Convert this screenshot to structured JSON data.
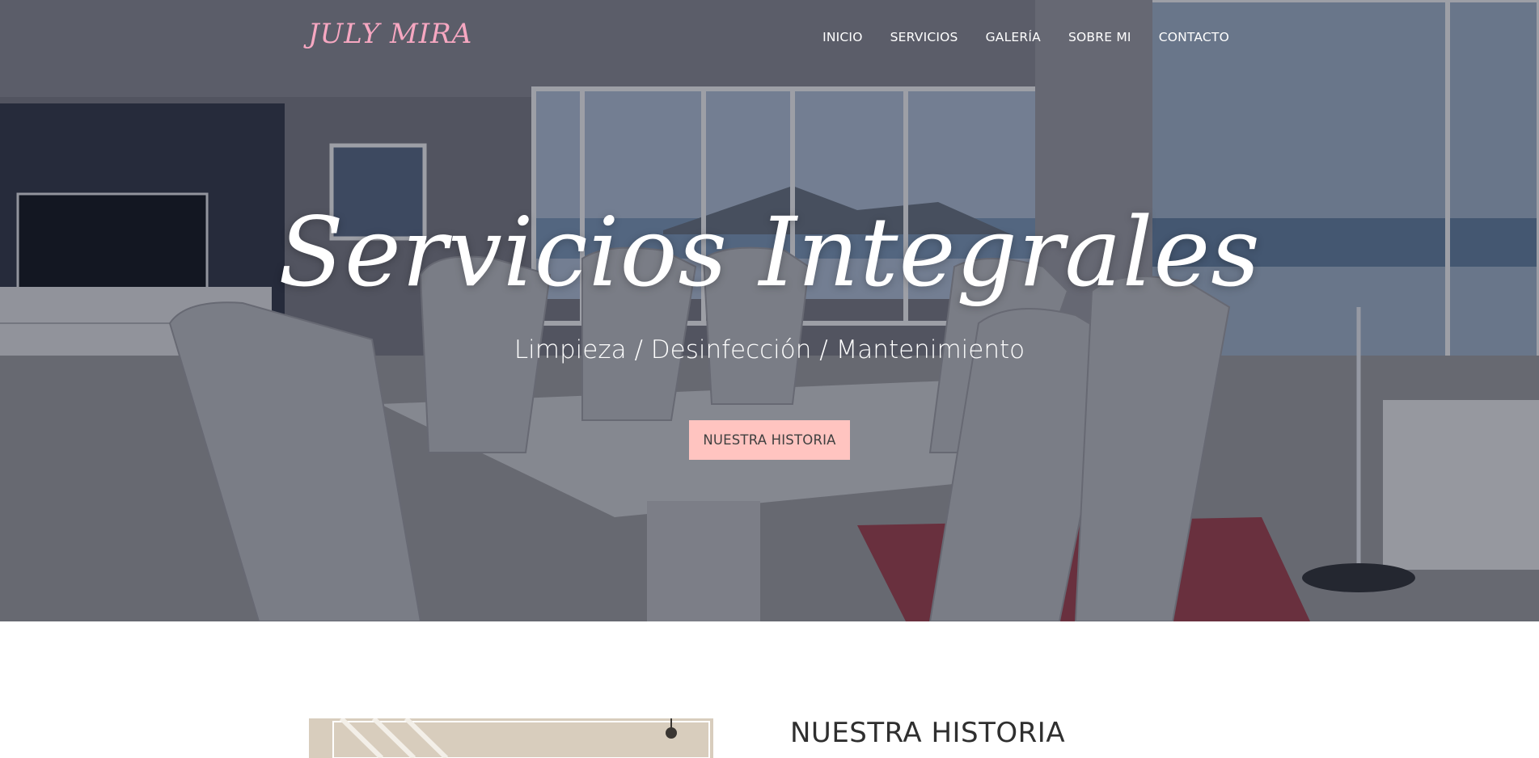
{
  "nav": {
    "brand": "JULY MIRA",
    "items": [
      {
        "label": "INICIO"
      },
      {
        "label": "SERVICIOS"
      },
      {
        "label": "GALERÍA"
      },
      {
        "label": "SOBRE MI"
      },
      {
        "label": "CONTACTO"
      }
    ]
  },
  "hero": {
    "title": "Servicios Integrales",
    "subtitle": "Limpieza / Desinfección / Mantenimiento",
    "button_label": "NUESTRA HISTORIA"
  },
  "story": {
    "heading": "NUESTRA HISTORIA"
  },
  "colors": {
    "brand_pink": "#f6a7c1",
    "button_bg": "#ffc4c0",
    "text_dark": "#2f2f2f"
  }
}
